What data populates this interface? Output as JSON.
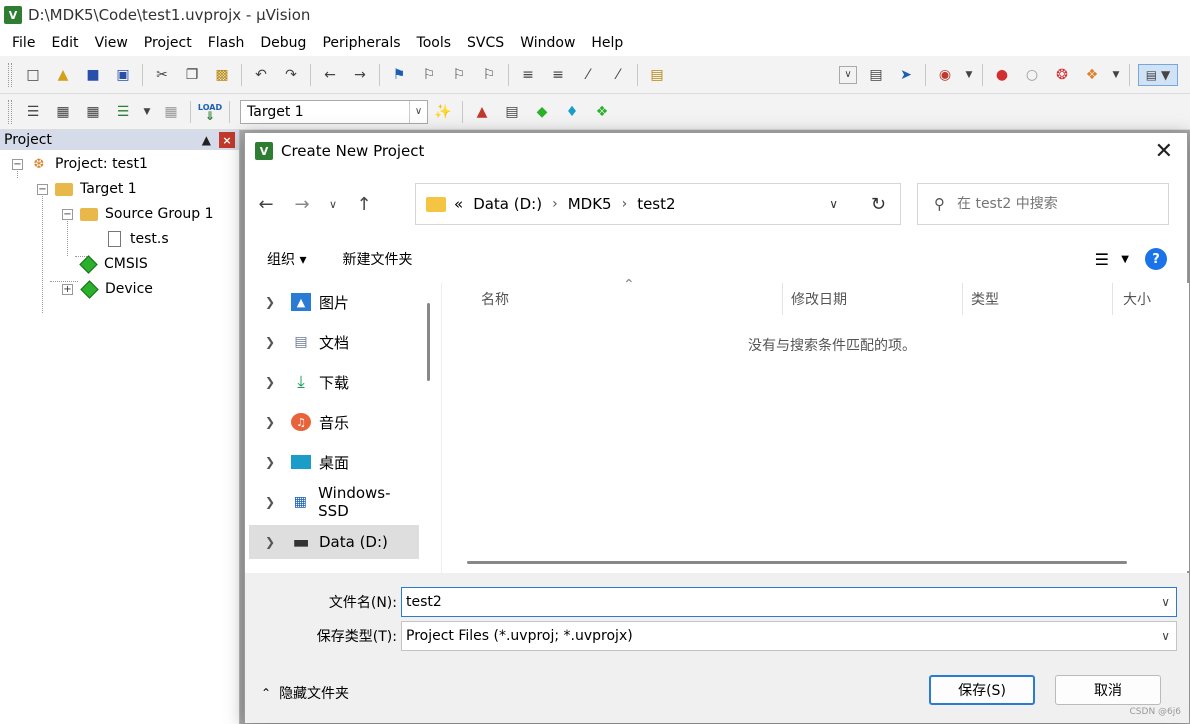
{
  "window": {
    "title": "D:\\MDK5\\Code\\test1.uvprojx - µVision",
    "app_icon_label": "V"
  },
  "menu": [
    "File",
    "Edit",
    "View",
    "Project",
    "Flash",
    "Debug",
    "Peripherals",
    "Tools",
    "SVCS",
    "Window",
    "Help"
  ],
  "toolbar2": {
    "load_label": "LOAD",
    "target": "Target 1"
  },
  "project_panel": {
    "title": "Project",
    "tree": {
      "project": "Project: test1",
      "target": "Target 1",
      "source_group": "Source Group 1",
      "file": "test.s",
      "cmsis": "CMSIS",
      "device": "Device"
    }
  },
  "dialog": {
    "title": "Create New Project",
    "address": {
      "prefix": "«",
      "crumbs": [
        "Data (D:)",
        "MDK5",
        "test2"
      ]
    },
    "search_placeholder": "在 test2 中搜索",
    "commands": {
      "organize": "组织 ▾",
      "new_folder": "新建文件夹"
    },
    "nav_items": [
      "图片",
      "文档",
      "下载",
      "音乐",
      "桌面",
      "Windows-SSD",
      "Data (D:)"
    ],
    "columns": [
      "名称",
      "修改日期",
      "类型",
      "大小"
    ],
    "empty_message": "没有与搜索条件匹配的项。",
    "filename_label": "文件名(N):",
    "filename_value": "test2",
    "filetype_label": "保存类型(T):",
    "filetype_value": "Project Files (*.uvproj; *.uvprojx)",
    "hide_folders": "隐藏文件夹",
    "save_button": "保存(S)",
    "cancel_button": "取消"
  },
  "watermark": "CSDN @6j6"
}
